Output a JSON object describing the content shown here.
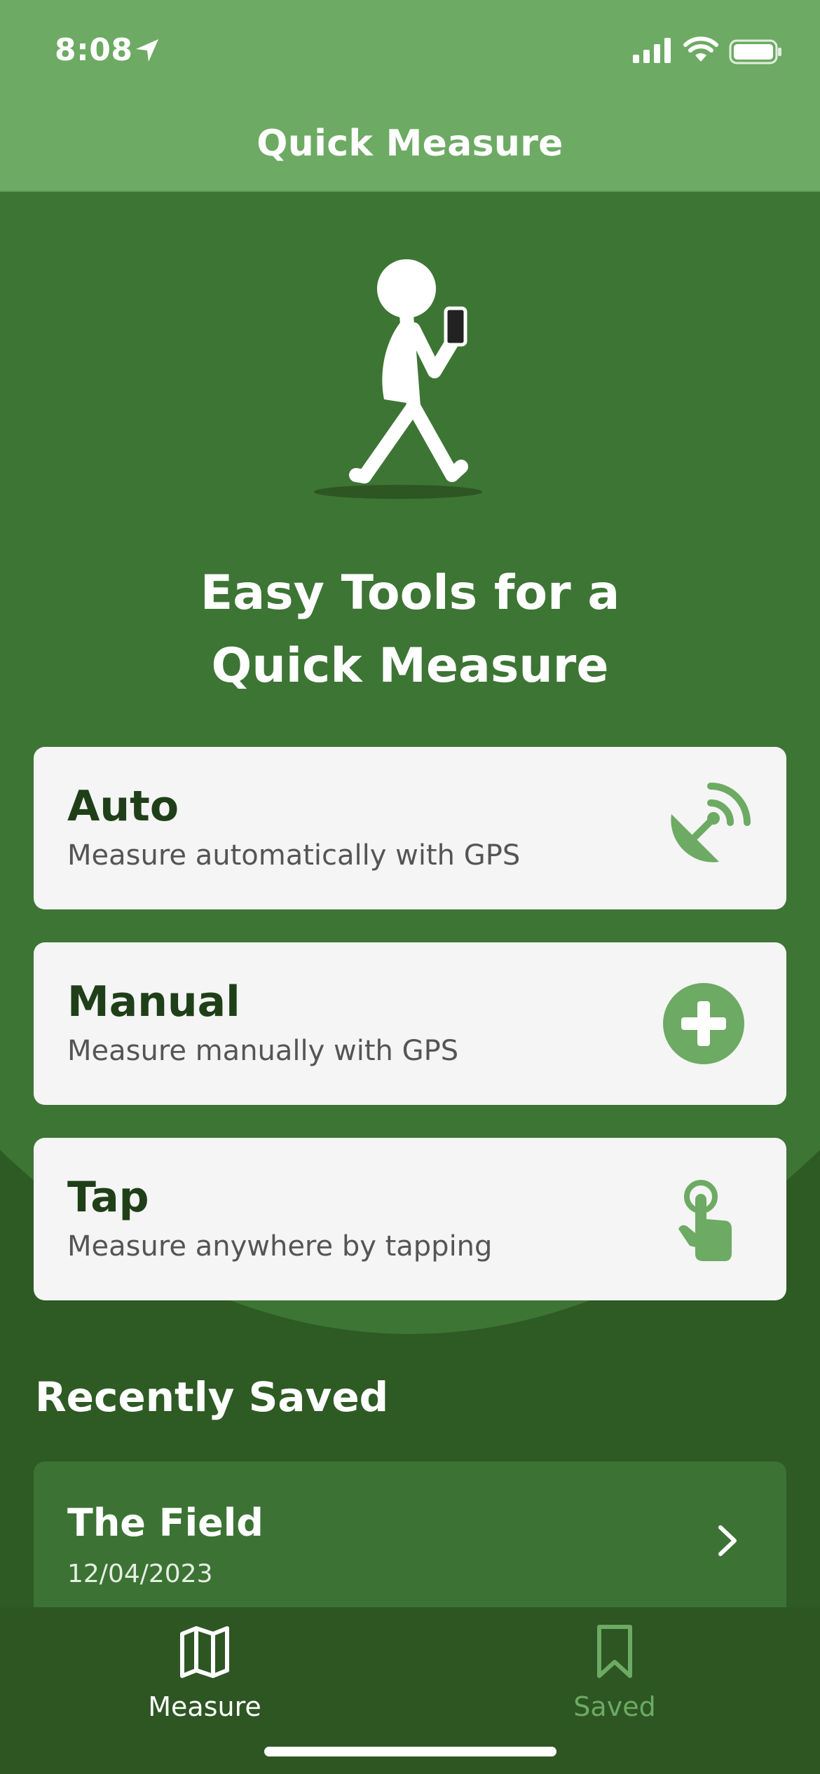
{
  "status_bar": {
    "time": "8:08"
  },
  "nav": {
    "title": "Quick Measure"
  },
  "hero": {
    "title_line1": "Easy Tools for a",
    "title_line2": "Quick Measure"
  },
  "modes": [
    {
      "title": "Auto",
      "subtitle": "Measure automatically with GPS",
      "icon": "satellite-dish-icon"
    },
    {
      "title": "Manual",
      "subtitle": "Measure manually with GPS",
      "icon": "plus-circle-icon"
    },
    {
      "title": "Tap",
      "subtitle": "Measure anywhere by tapping",
      "icon": "tap-hand-icon"
    }
  ],
  "recently_saved": {
    "title": "Recently Saved",
    "items": [
      {
        "name": "The Field",
        "date": "12/04/2023"
      }
    ]
  },
  "tabs": [
    {
      "label": "Measure",
      "icon": "map-icon",
      "active": true
    },
    {
      "label": "Saved",
      "icon": "bookmark-icon",
      "active": false
    }
  ],
  "colors": {
    "header": "#6daa63",
    "background": "#2e5a24",
    "arc": "#3d7534",
    "accent": "#6daa63",
    "card": "#f5f5f5",
    "card_title": "#1f3f18"
  }
}
